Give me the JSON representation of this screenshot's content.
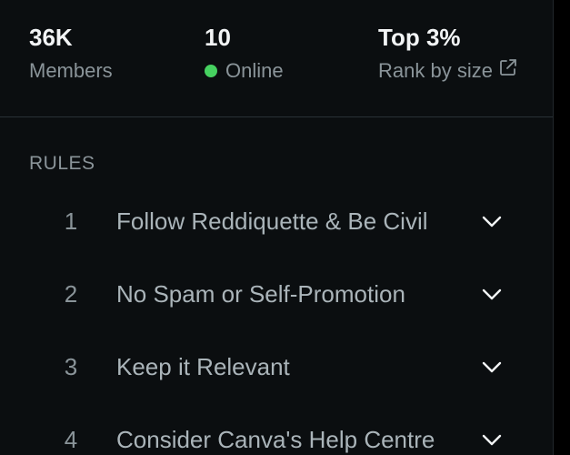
{
  "stats": {
    "members": {
      "value": "36K",
      "label": "Members"
    },
    "online": {
      "value": "10",
      "label": "Online",
      "dot_color": "#46d160"
    },
    "rank": {
      "value": "Top 3%",
      "label": "Rank by size",
      "icon": "external-link-icon"
    }
  },
  "rules": {
    "heading": "RULES",
    "items": [
      {
        "number": "1",
        "title": "Follow Reddiquette & Be Civil",
        "icon": "chevron-down-icon"
      },
      {
        "number": "2",
        "title": "No Spam or Self-Promotion",
        "icon": "chevron-down-icon"
      },
      {
        "number": "3",
        "title": "Keep it Relevant",
        "icon": "chevron-down-icon"
      },
      {
        "number": "4",
        "title": "Consider Canva's Help Centre",
        "icon": "chevron-down-icon"
      }
    ]
  },
  "colors": {
    "background": "#0b0e10",
    "text_primary": "#f2f4f5",
    "text_secondary": "#8a9499",
    "online": "#46d160"
  }
}
